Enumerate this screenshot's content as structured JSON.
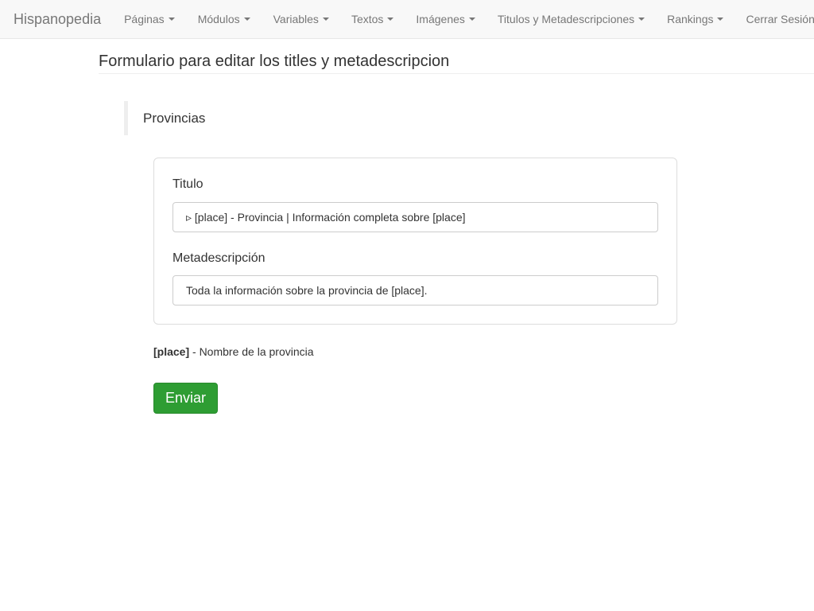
{
  "navbar": {
    "brand": "Hispanopedia",
    "items": [
      {
        "label": "Páginas",
        "dropdown": true
      },
      {
        "label": "Módulos",
        "dropdown": true
      },
      {
        "label": "Variables",
        "dropdown": true
      },
      {
        "label": "Textos",
        "dropdown": true
      },
      {
        "label": "Imágenes",
        "dropdown": true
      },
      {
        "label": "Titulos y Metadescripciones",
        "dropdown": true
      },
      {
        "label": "Rankings",
        "dropdown": true
      },
      {
        "label": "Cerrar Sesión",
        "dropdown": false
      }
    ]
  },
  "page": {
    "title": "Formulario para editar los titles y metadescripcion",
    "section": "Provincias"
  },
  "form": {
    "title_label": "Titulo",
    "title_value": "▹ [place] - Provincia | Información completa sobre [place]",
    "meta_label": "Metadescripción",
    "meta_value": "Toda la información sobre la provincia de [place].",
    "help_key": "[place]",
    "help_text": " - Nombre de la provincia",
    "submit_label": "Enviar"
  },
  "colors": {
    "navbar_bg": "#f8f8f8",
    "submit_bg": "#2e9d33"
  }
}
